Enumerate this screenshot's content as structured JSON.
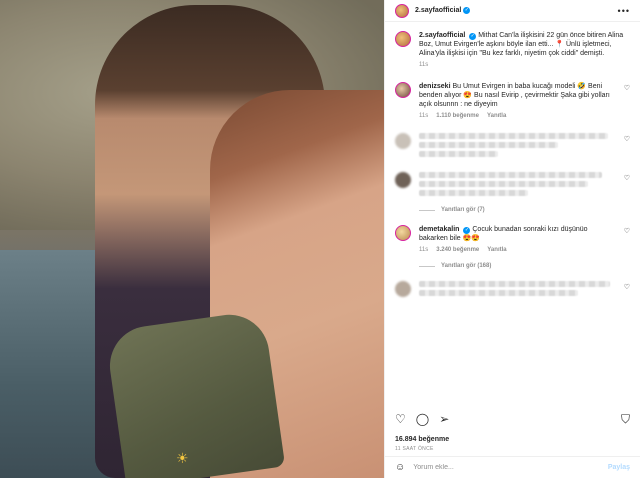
{
  "post": {
    "username": "2.sayfaofficial",
    "caption": "Mithat Can'la ilişkisini 22 gün önce bitiren Alina Boz, Umut Evirgen'le aşkını böyle ilan etti... 📍 Ünlü işletmeci, Alina'yla ilişkisi için \"Bu kez farklı, niyetim çok ciddi\" demişti.",
    "caption_age": "11s",
    "likes": "16.894 beğenme",
    "time_ago": "11 SAAT ÖNCE"
  },
  "comments": [
    {
      "username": "denizseki",
      "text": "Bu Umut Evirgen in baba kucağı modeli 🤣 Beni benden alıyor 😍 Bu nasıl Evirip , çevirmektir Şaka gibi yolları açık olsunnn : ne diyeyim",
      "age": "11s",
      "likes": "1.110 beğenme",
      "reply": "Yanıtla"
    },
    {
      "username": "demetakalin",
      "text": "Çocuk bunadan sonraki kızı düşünüo bakarken bile 😍😍",
      "age": "11s",
      "likes": "3.240 beğenme",
      "reply": "Yanıtla"
    }
  ],
  "replies": {
    "first": "Yanıtları gör (7)",
    "second": "Yanıtları gör (168)"
  },
  "add_comment": {
    "placeholder": "Yorum ekle...",
    "post_label": "Paylaş"
  },
  "icons": {
    "more": "more-icon",
    "heart": "heart-icon",
    "comment": "comment-icon",
    "share": "share-icon",
    "bookmark": "bookmark-icon",
    "emoji": "emoji-icon"
  },
  "colors": {
    "accent": "#0095f6",
    "text": "#262626",
    "muted": "#8e8e8e"
  }
}
